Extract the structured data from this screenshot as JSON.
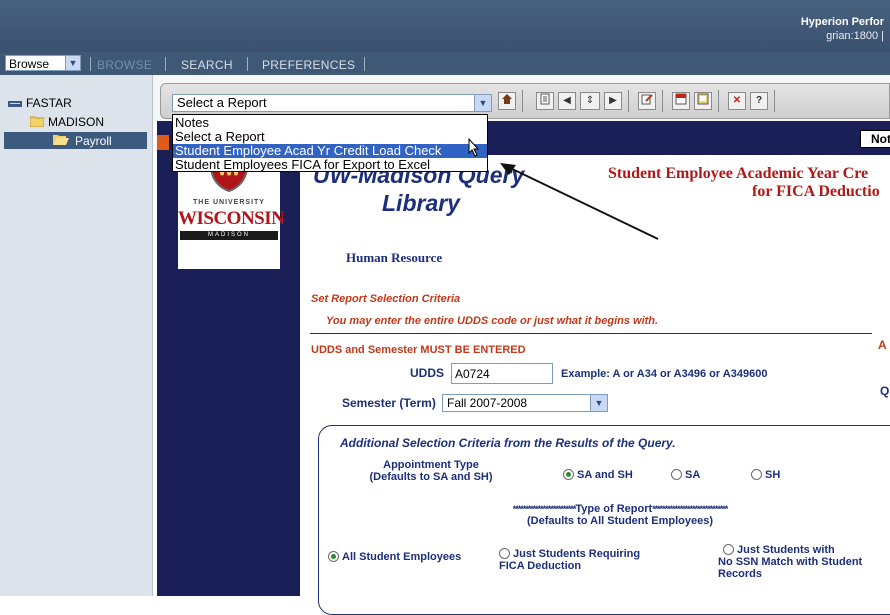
{
  "header": {
    "title": "Hyperion Perfor",
    "subtitle": "grian:1800 |"
  },
  "menubar": {
    "browse_select": "Browse",
    "items": [
      "BROWSE",
      "SEARCH",
      "PREFERENCES"
    ]
  },
  "sidebar": {
    "root": "FASTAR",
    "folder": "MADISON",
    "selected": "Payroll"
  },
  "toolbar": {
    "report_select": "Select a Report",
    "icons": [
      "home-icon",
      "page-icon",
      "prev-page-icon",
      "page-range-icon",
      "next-page-icon",
      "edit-icon",
      "pdf-icon",
      "export-icon",
      "close-icon",
      "help-icon"
    ]
  },
  "dropdown": {
    "options": [
      "Notes",
      "Select a Report",
      "Student Employee Acad Yr Credit Load Check",
      "Student Employees FICA for Export to Excel"
    ],
    "selected_index": 2
  },
  "content": {
    "not_button": "Not",
    "logo_top": "THE UNIVERSITY",
    "logo_mid": "WISCONSIN",
    "logo_bottom": "MADISON",
    "library_line1": "UW-Madison Query",
    "library_line2": "Library",
    "report_title_line1": "Student Employee Academic Year Cre",
    "report_title_line2": "for FICA Deductio",
    "human_resource": "Human Resource",
    "set_criteria": "Set Report Selection Criteria",
    "criteria_hint": "You may enter the entire UDDS code or just what it begins with.",
    "must_enter": "UDDS and Semester MUST BE ENTERED",
    "right_a": "A",
    "right_q": "Q",
    "udds_label": "UDDS",
    "udds_value": "A0724",
    "udds_example": "Example: A or A34 or A3496 or A349600",
    "semester_label": "Semester (Term)",
    "semester_value": "Fall 2007-2008",
    "additional_title": "Additional Selection Criteria from the Results of the Query.",
    "appt_type_line1": "Appointment Type",
    "appt_type_line2": "(Defaults to SA and SH)",
    "appt_options": [
      "SA and SH",
      "SA",
      "SH"
    ],
    "type_report_line1": "Type of Report",
    "type_report_line2": "(Defaults to All Student Employees)",
    "report_opt1": "All Student Employees",
    "report_opt2_line1": "Just Students Requiring",
    "report_opt2_line2": "FICA Deduction",
    "report_opt3_line1": "Just Students with",
    "report_opt3_line2": "No SSN Match with Student",
    "report_opt3_line3": "Records"
  },
  "colors": {
    "header_bg": "#48617e",
    "sidebar_selected": "#3c5a7e",
    "content_dark": "#1a2057",
    "title_red": "#b01818",
    "dropdown_highlight": "#3163c5"
  }
}
